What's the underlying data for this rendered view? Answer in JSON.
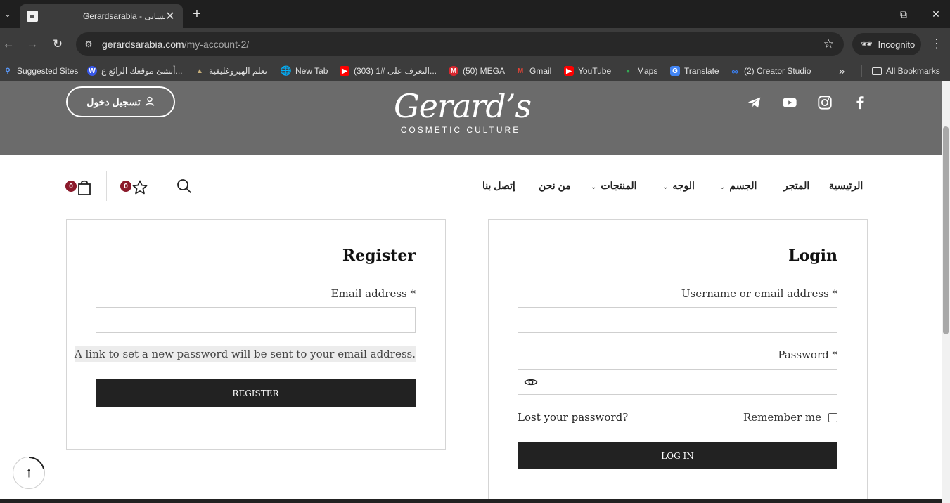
{
  "browser": {
    "tab_title": "Gerardsarabia - حسابى",
    "url_host": "gerardsarabia.com",
    "url_path": "/my-account-2/",
    "incognito_label": "Incognito",
    "bookmarks": [
      {
        "label": "Suggested Sites",
        "icon": "search-icon"
      },
      {
        "label": "أنشئ موقعك الرائع ع...",
        "icon": "wordpress-icon"
      },
      {
        "label": "تعلم الهيروغليفية",
        "icon": "pyramid-icon"
      },
      {
        "label": "New Tab",
        "icon": "globe-icon"
      },
      {
        "label": "(303) التعرف على #1...",
        "icon": "youtube-icon"
      },
      {
        "label": "(50) MEGA",
        "icon": "mega-icon"
      },
      {
        "label": "Gmail",
        "icon": "gmail-icon"
      },
      {
        "label": "YouTube",
        "icon": "youtube-icon"
      },
      {
        "label": "Maps",
        "icon": "maps-icon"
      },
      {
        "label": "Translate",
        "icon": "translate-icon"
      },
      {
        "label": "(2) Creator Studio",
        "icon": "meta-icon"
      }
    ],
    "all_bookmarks_label": "All Bookmarks",
    "overflow_label": "»"
  },
  "header": {
    "login_button": "تسجيل دخول",
    "logo_main": "Gerard’s",
    "logo_sub": "COSMETIC CULTURE",
    "social_icons": [
      "telegram-icon",
      "youtube-icon",
      "instagram-icon",
      "facebook-icon"
    ]
  },
  "nav": {
    "home": "الرئيسية",
    "shop": "المتجر",
    "body": "الجسم",
    "face": "الوجه",
    "products": "المنتجات",
    "about": "من نحن",
    "contact": "إتصل بنا",
    "wishlist_count": "0",
    "cart_count": "0"
  },
  "login": {
    "title": "Login",
    "username_label": "Username or email address *",
    "password_label": "Password *",
    "remember_label": "Remember me",
    "lost_password": "Lost your password?",
    "button": "LOG IN"
  },
  "register": {
    "title": "Register",
    "email_label": "Email address *",
    "hint": "A link to set a new password will be sent to your email address.",
    "button": "REGISTER"
  },
  "colors": {
    "header_band": "#6b6b6b",
    "badge": "#8b1a2b",
    "button_dark": "#222222"
  }
}
